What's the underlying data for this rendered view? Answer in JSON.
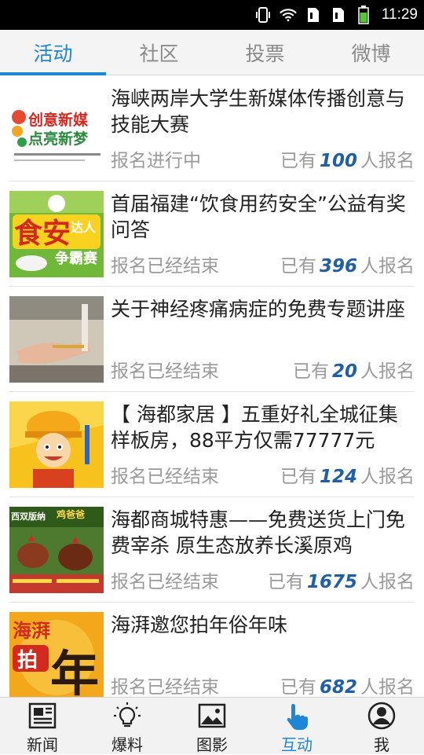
{
  "status_bar": {
    "time": "11:29"
  },
  "tabs": [
    {
      "label": "活动"
    },
    {
      "label": "社区"
    },
    {
      "label": "投票"
    },
    {
      "label": "微博"
    }
  ],
  "items": [
    {
      "title": "海峡两岸大学生新媒体传播创意与技能大赛",
      "status": "报名进行中",
      "count_prefix": "已有",
      "count": "100",
      "count_suffix": "人报名",
      "thumb_text": "创意新媒 点亮新梦"
    },
    {
      "title": "首届福建“饮食用药安全”公益有奖问答",
      "status": "报名已经结束",
      "count_prefix": "已有",
      "count": "396",
      "count_suffix": "人报名",
      "thumb_text": "食安达人 争霸赛"
    },
    {
      "title": "关于神经疼痛病症的免费专题讲座",
      "status": "报名已经结束",
      "count_prefix": "已有",
      "count": "20",
      "count_suffix": "人报名",
      "thumb_text": ""
    },
    {
      "title": "【 海都家居 】五重好礼全城征集样板房，88平方仅需77777元",
      "status": "报名已经结束",
      "count_prefix": "已有",
      "count": "124",
      "count_suffix": "人报名",
      "thumb_text": ""
    },
    {
      "title": "海都商城特惠——免费送货上门免费宰杀 原生态放养长溪原鸡",
      "status": "报名已经结束",
      "count_prefix": "已有",
      "count": "1675",
      "count_suffix": "人报名",
      "thumb_text": "西双版纳 鸡爸爸"
    },
    {
      "title": "海湃邀您拍年俗年味",
      "status": "报名已经结束",
      "count_prefix": "已有",
      "count": "682",
      "count_suffix": "人报名",
      "thumb_text": "海湃 拍 年"
    }
  ],
  "bottom_nav": [
    {
      "label": "新闻",
      "icon": "newspaper-icon"
    },
    {
      "label": "爆料",
      "icon": "lightbulb-icon"
    },
    {
      "label": "图影",
      "icon": "picture-icon"
    },
    {
      "label": "互动",
      "icon": "hand-tap-icon"
    },
    {
      "label": "我",
      "icon": "user-icon"
    }
  ],
  "colors": {
    "accent": "#1e86d6",
    "count": "#1f5fa5"
  }
}
